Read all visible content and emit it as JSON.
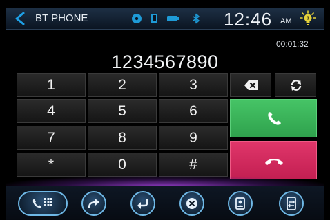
{
  "header": {
    "title": "BT PHONE",
    "time": "12:46",
    "ampm": "AM",
    "icons": [
      "back-arrow-icon",
      "media-disc-icon",
      "phone-device-icon",
      "battery-icon",
      "bluetooth-icon",
      "brightness-icon"
    ]
  },
  "call": {
    "timer": "00:01:32",
    "number": "1234567890"
  },
  "keypad": {
    "keys": [
      "1",
      "2",
      "3",
      "4",
      "5",
      "6",
      "7",
      "8",
      "9",
      "*",
      "0",
      "#"
    ]
  },
  "actions": {
    "call_color": "#3bb45a",
    "end_color": "#d42a5e",
    "icons": [
      "backspace-icon",
      "redial-icon",
      "call-icon",
      "end-call-icon"
    ]
  },
  "bottom_bar": {
    "icons": [
      "dialpad-icon",
      "forward-icon",
      "return-icon",
      "close-icon",
      "contacts-icon",
      "phone-transfer-icon"
    ]
  },
  "colors": {
    "accent": "#1ea0e6",
    "glow": "#a046e6"
  }
}
